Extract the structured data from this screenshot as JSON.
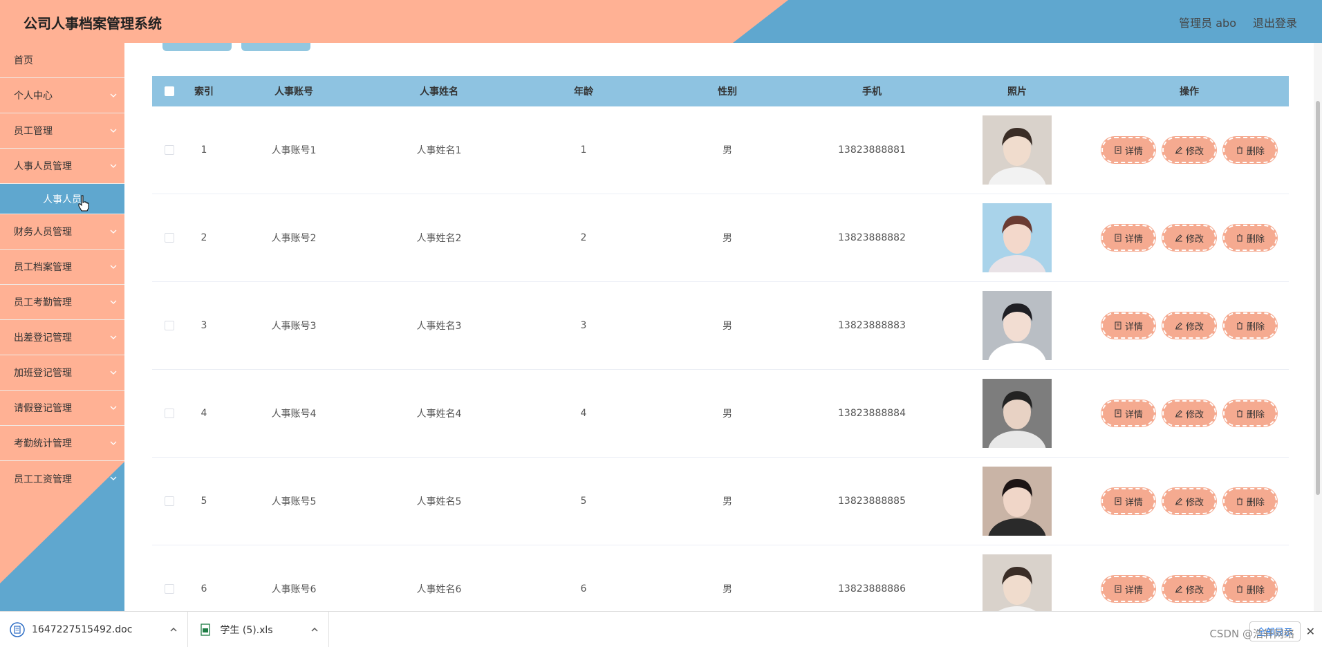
{
  "header": {
    "title": "公司人事档案管理系统",
    "user": "管理员 abo",
    "logout": "退出登录",
    "colors": {
      "left": "#ffb194",
      "right": "#5fa7cf"
    }
  },
  "sidebar": {
    "items": [
      {
        "label": "首页",
        "has_chevron": false
      },
      {
        "label": "个人中心",
        "has_chevron": true
      },
      {
        "label": "员工管理",
        "has_chevron": true
      },
      {
        "label": "人事人员管理",
        "has_chevron": true,
        "expanded": true
      },
      {
        "label": "财务人员管理",
        "has_chevron": true
      },
      {
        "label": "员工档案管理",
        "has_chevron": true
      },
      {
        "label": "员工考勤管理",
        "has_chevron": true
      },
      {
        "label": "出差登记管理",
        "has_chevron": true
      },
      {
        "label": "加班登记管理",
        "has_chevron": true
      },
      {
        "label": "请假登记管理",
        "has_chevron": true
      },
      {
        "label": "考勤统计管理",
        "has_chevron": true
      },
      {
        "label": "员工工资管理",
        "has_chevron": true
      }
    ],
    "submenu_active": "人事人员"
  },
  "table": {
    "headers": [
      "索引",
      "人事账号",
      "人事姓名",
      "年龄",
      "性别",
      "手机",
      "照片",
      "操作"
    ],
    "rows": [
      {
        "index": "1",
        "account": "人事账号1",
        "name": "人事姓名1",
        "age": "1",
        "sex": "男",
        "phone": "13823888881"
      },
      {
        "index": "2",
        "account": "人事账号2",
        "name": "人事姓名2",
        "age": "2",
        "sex": "男",
        "phone": "13823888882"
      },
      {
        "index": "3",
        "account": "人事账号3",
        "name": "人事姓名3",
        "age": "3",
        "sex": "男",
        "phone": "13823888883"
      },
      {
        "index": "4",
        "account": "人事账号4",
        "name": "人事姓名4",
        "age": "4",
        "sex": "男",
        "phone": "13823888884"
      },
      {
        "index": "5",
        "account": "人事账号5",
        "name": "人事姓名5",
        "age": "5",
        "sex": "男",
        "phone": "13823888885"
      },
      {
        "index": "6",
        "account": "人事账号6",
        "name": "人事姓名6",
        "age": "6",
        "sex": "男",
        "phone": "13823888886"
      }
    ],
    "actions": {
      "detail": "详情",
      "edit": "修改",
      "delete": "删除"
    }
  },
  "downloads": {
    "items": [
      {
        "name": "1647227515492.doc",
        "icon": "doc-icon"
      },
      {
        "name": "学生 (5).xls",
        "icon": "xls-icon"
      }
    ],
    "show_all": "全部显示"
  },
  "watermark": "CSDN @浩轩网络"
}
